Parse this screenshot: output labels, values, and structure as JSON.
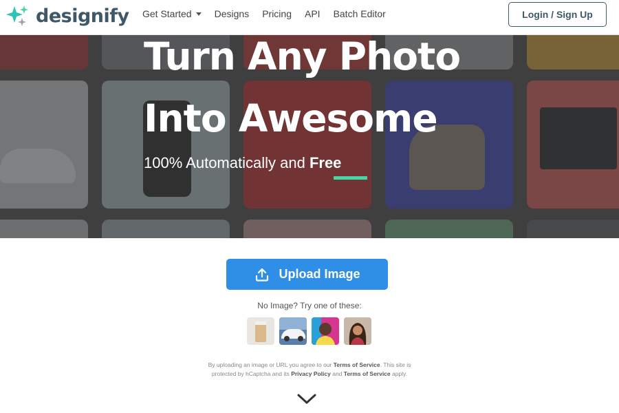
{
  "brand": {
    "name": "designify",
    "logo_icon": "sparkle-icon",
    "accent_green": "#45d6a0",
    "accent_teal": "#2ec4b6"
  },
  "nav": {
    "links": [
      {
        "label": "Get Started",
        "has_dropdown": true
      },
      {
        "label": "Designs"
      },
      {
        "label": "Pricing"
      },
      {
        "label": "API"
      },
      {
        "label": "Batch Editor"
      }
    ],
    "login_label": "Login / Sign Up"
  },
  "hero": {
    "title_line1": "Turn Any Photo",
    "title_line2": "Into Awesome",
    "subtitle_prefix": "100% Automatically and ",
    "subtitle_emphasis": "Free",
    "underline_color": "#45d6a0"
  },
  "upload": {
    "button_label": "Upload Image",
    "button_icon": "upload-icon",
    "button_color": "#2f8fe6",
    "try_text": "No Image? Try one of these:",
    "samples": [
      "cup-sample",
      "car-sample",
      "man-sample",
      "woman-sample"
    ]
  },
  "terms": {
    "t1": "By uploading an image or URL you agree to our ",
    "tos": "Terms of Service",
    "t2": ". This site is",
    "t3": "protected by hCaptcha and its ",
    "privacy": "Privacy Policy",
    "t4": " and ",
    "tos2": "Terms of Service",
    "t5": " apply."
  },
  "scroll_icon": "chevron-down-icon"
}
